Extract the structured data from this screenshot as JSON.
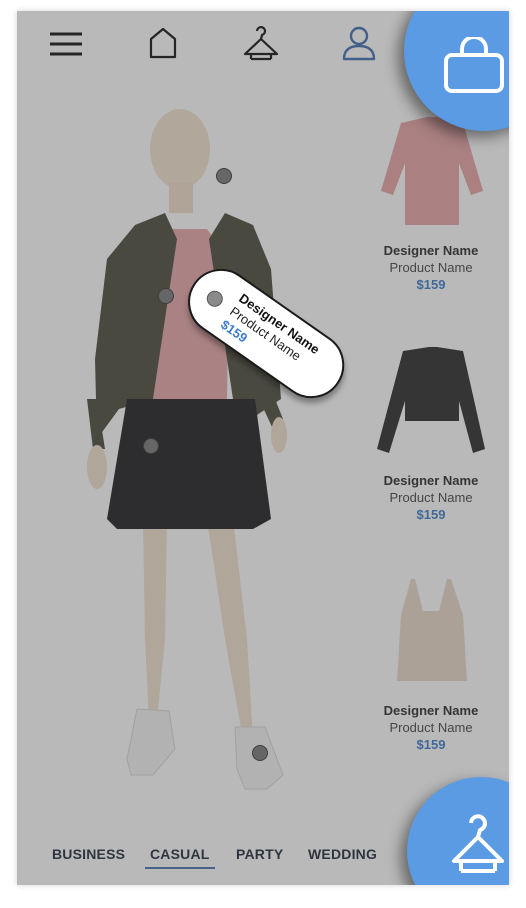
{
  "nav": {
    "menu_icon": "hamburger-icon",
    "home_icon": "home-icon",
    "hanger_icon": "hanger-icon",
    "profile_icon": "user-icon"
  },
  "products": [
    {
      "designer": "Designer Name",
      "name": "Product Name",
      "price": "$159",
      "item": "pink floral blouse"
    },
    {
      "designer": "Designer Name",
      "name": "Product Name",
      "price": "$159",
      "item": "black lace jacket"
    },
    {
      "designer": "Designer Name",
      "name": "Product Name",
      "price": "$159",
      "item": "beige camisole"
    }
  ],
  "tag": {
    "designer": "Designer Name",
    "name": "Product Name",
    "price": "$159"
  },
  "tabs": [
    {
      "label": "BUSINESS"
    },
    {
      "label": "CASUAL",
      "selected": true
    },
    {
      "label": "PARTY"
    },
    {
      "label": "WEDDING"
    }
  ],
  "fab": {
    "bag_icon": "shopping-bag-icon",
    "hanger_icon": "hanger-icon"
  },
  "colors": {
    "accent": "#5b9be3",
    "price": "#3d7ccc",
    "overlay": "#464646"
  }
}
